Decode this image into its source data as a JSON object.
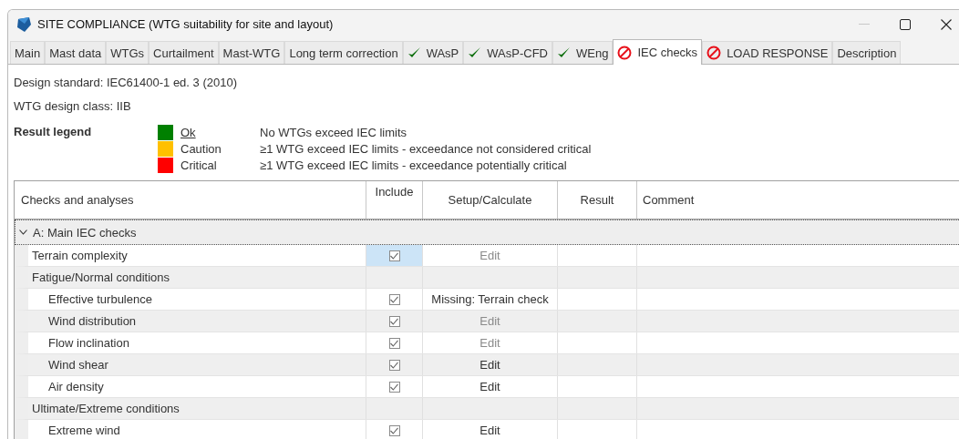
{
  "window": {
    "title": "SITE COMPLIANCE (WTG suitability for site and layout)",
    "minimize_disabled": true
  },
  "tabs": [
    {
      "label": "Main",
      "kind": "plain",
      "selected": false
    },
    {
      "label": "Mast data",
      "kind": "plain",
      "selected": false
    },
    {
      "label": "WTGs",
      "kind": "plain",
      "selected": false
    },
    {
      "label": "Curtailment",
      "kind": "plain",
      "selected": false
    },
    {
      "label": "Mast-WTG",
      "kind": "plain",
      "selected": false
    },
    {
      "label": "Long term correction",
      "kind": "plain",
      "selected": false
    },
    {
      "label": "WAsP",
      "kind": "ok",
      "selected": false
    },
    {
      "label": "WAsP-CFD",
      "kind": "ok",
      "selected": false
    },
    {
      "label": "WEng",
      "kind": "ok",
      "selected": false
    },
    {
      "label": "IEC checks",
      "kind": "blocked",
      "selected": true
    },
    {
      "label": "LOAD RESPONSE",
      "kind": "blocked",
      "selected": false
    },
    {
      "label": "Description",
      "kind": "plain",
      "selected": false
    }
  ],
  "design_standard": "Design standard: IEC61400-1 ed. 3 (2010)",
  "design_class": "WTG design class: IIB",
  "legend": {
    "title": "Result legend",
    "items": [
      {
        "label": "Ok",
        "color": "#008000",
        "description": "No WTGs exceed IEC limits"
      },
      {
        "label": "Caution",
        "color": "#ffc000",
        "description": "≥1 WTG exceed IEC limits - exceedance not considered critical"
      },
      {
        "label": "Critical",
        "color": "#ff0000",
        "description": "≥1 WTG exceed IEC limits - exceedance potentially critical"
      }
    ]
  },
  "table": {
    "columns": [
      "Checks and analyses",
      "Include",
      "Setup/Calculate",
      "Result",
      "Comment"
    ],
    "groups": [
      {
        "label": "A: Main IEC checks",
        "expanded": true,
        "children": [
          {
            "kind": "check",
            "name": "Terrain complexity",
            "include": true,
            "include_selected": true,
            "setup": "Edit",
            "setup_enabled": false
          },
          {
            "kind": "subgroup",
            "name": "Fatigue/Normal conditions",
            "children": [
              {
                "kind": "check",
                "name": "Effective turbulence",
                "include": true,
                "include_selected": false,
                "setup": "Missing: Terrain check",
                "setup_enabled": true
              },
              {
                "kind": "check",
                "name": "Wind distribution",
                "include": true,
                "include_selected": false,
                "setup": "Edit",
                "setup_enabled": false
              },
              {
                "kind": "check",
                "name": "Flow inclination",
                "include": true,
                "include_selected": false,
                "setup": "Edit",
                "setup_enabled": false
              },
              {
                "kind": "check",
                "name": "Wind shear",
                "include": true,
                "include_selected": false,
                "setup": "Edit",
                "setup_enabled": true
              },
              {
                "kind": "check",
                "name": "Air density",
                "include": true,
                "include_selected": false,
                "setup": "Edit",
                "setup_enabled": true
              }
            ]
          },
          {
            "kind": "subgroup",
            "name": "Ultimate/Extreme conditions",
            "children": [
              {
                "kind": "check",
                "name": "Extreme wind",
                "include": true,
                "include_selected": false,
                "setup": "Edit",
                "setup_enabled": true
              }
            ]
          }
        ]
      }
    ]
  }
}
